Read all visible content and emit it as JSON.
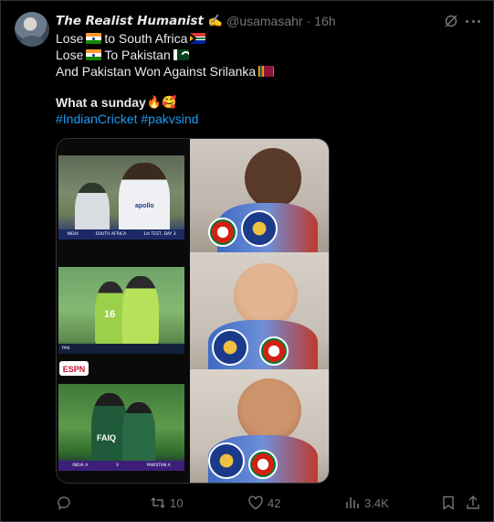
{
  "author": {
    "name": "The Realist Humanist",
    "name_emoji": "✍️",
    "handle": "@usamasahr",
    "time": "16h"
  },
  "tweet": {
    "line1_a": "Lose",
    "line1_b": "to South Africa",
    "line2_a": "Lose",
    "line2_b": "To Pakistan",
    "line3": "And Pakistan Won Against Srilanka",
    "line4": "What a sunday",
    "line4_emoji": "🔥🥰",
    "hashtag1": "#IndianCricket",
    "hashtag2": "#pakvsind"
  },
  "media": {
    "frame1_caption_left": "INDIA",
    "frame1_caption_mid": "SOUTH AFRICA",
    "frame1_caption_right": "1st TEST, DAY 3",
    "frame1_jersey": "apollo",
    "frame2_jersey": "16",
    "frame2_caption_left": "PAK",
    "frame3_jersey": "FAIQ",
    "frame3_caption_left": "INDIA A",
    "frame3_caption_mid": "V",
    "frame3_caption_right": "PAKISTAN A",
    "badge_text": "ESPN"
  },
  "actions": {
    "reply_count": "",
    "retweet_count": "10",
    "like_count": "42",
    "views_count": "3.4K"
  },
  "colors": {
    "background": "#000000",
    "text": "#e7e9ea",
    "muted": "#71767b",
    "link": "#1d9bf0",
    "border": "#2f3336"
  },
  "icons": [
    "grok-icon",
    "more-icon",
    "reply-icon",
    "retweet-icon",
    "like-icon",
    "views-icon",
    "bookmark-icon",
    "share-icon"
  ]
}
